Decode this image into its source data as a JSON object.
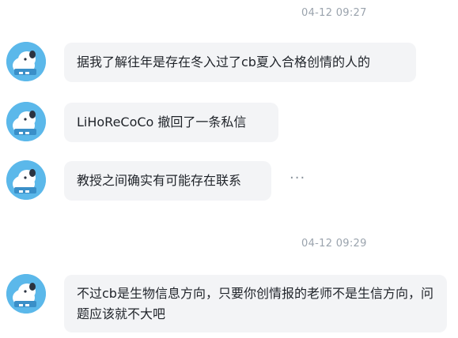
{
  "messages": [
    {
      "time": "04-12 09:27",
      "text": "据我了解往年是存在冬入过了cb夏入合格创情的人的"
    },
    {
      "text": "LiHoReCoCo 撤回了一条私信"
    },
    {
      "text": "教授之间确实有可能存在联系",
      "more": "···"
    },
    {
      "time": "04-12 09:29",
      "text": "不过cb是生物信息方向，只要你创情报的老师不是生信方向，问题应该就不大吧"
    }
  ],
  "colors": {
    "avatar": "#5bb8ea",
    "bubble": "#f3f4f6",
    "timestamp": "#9aa3ad"
  },
  "icons": {
    "avatar": "cartoon-dog-avatar-icon",
    "more": "more-options-icon"
  }
}
